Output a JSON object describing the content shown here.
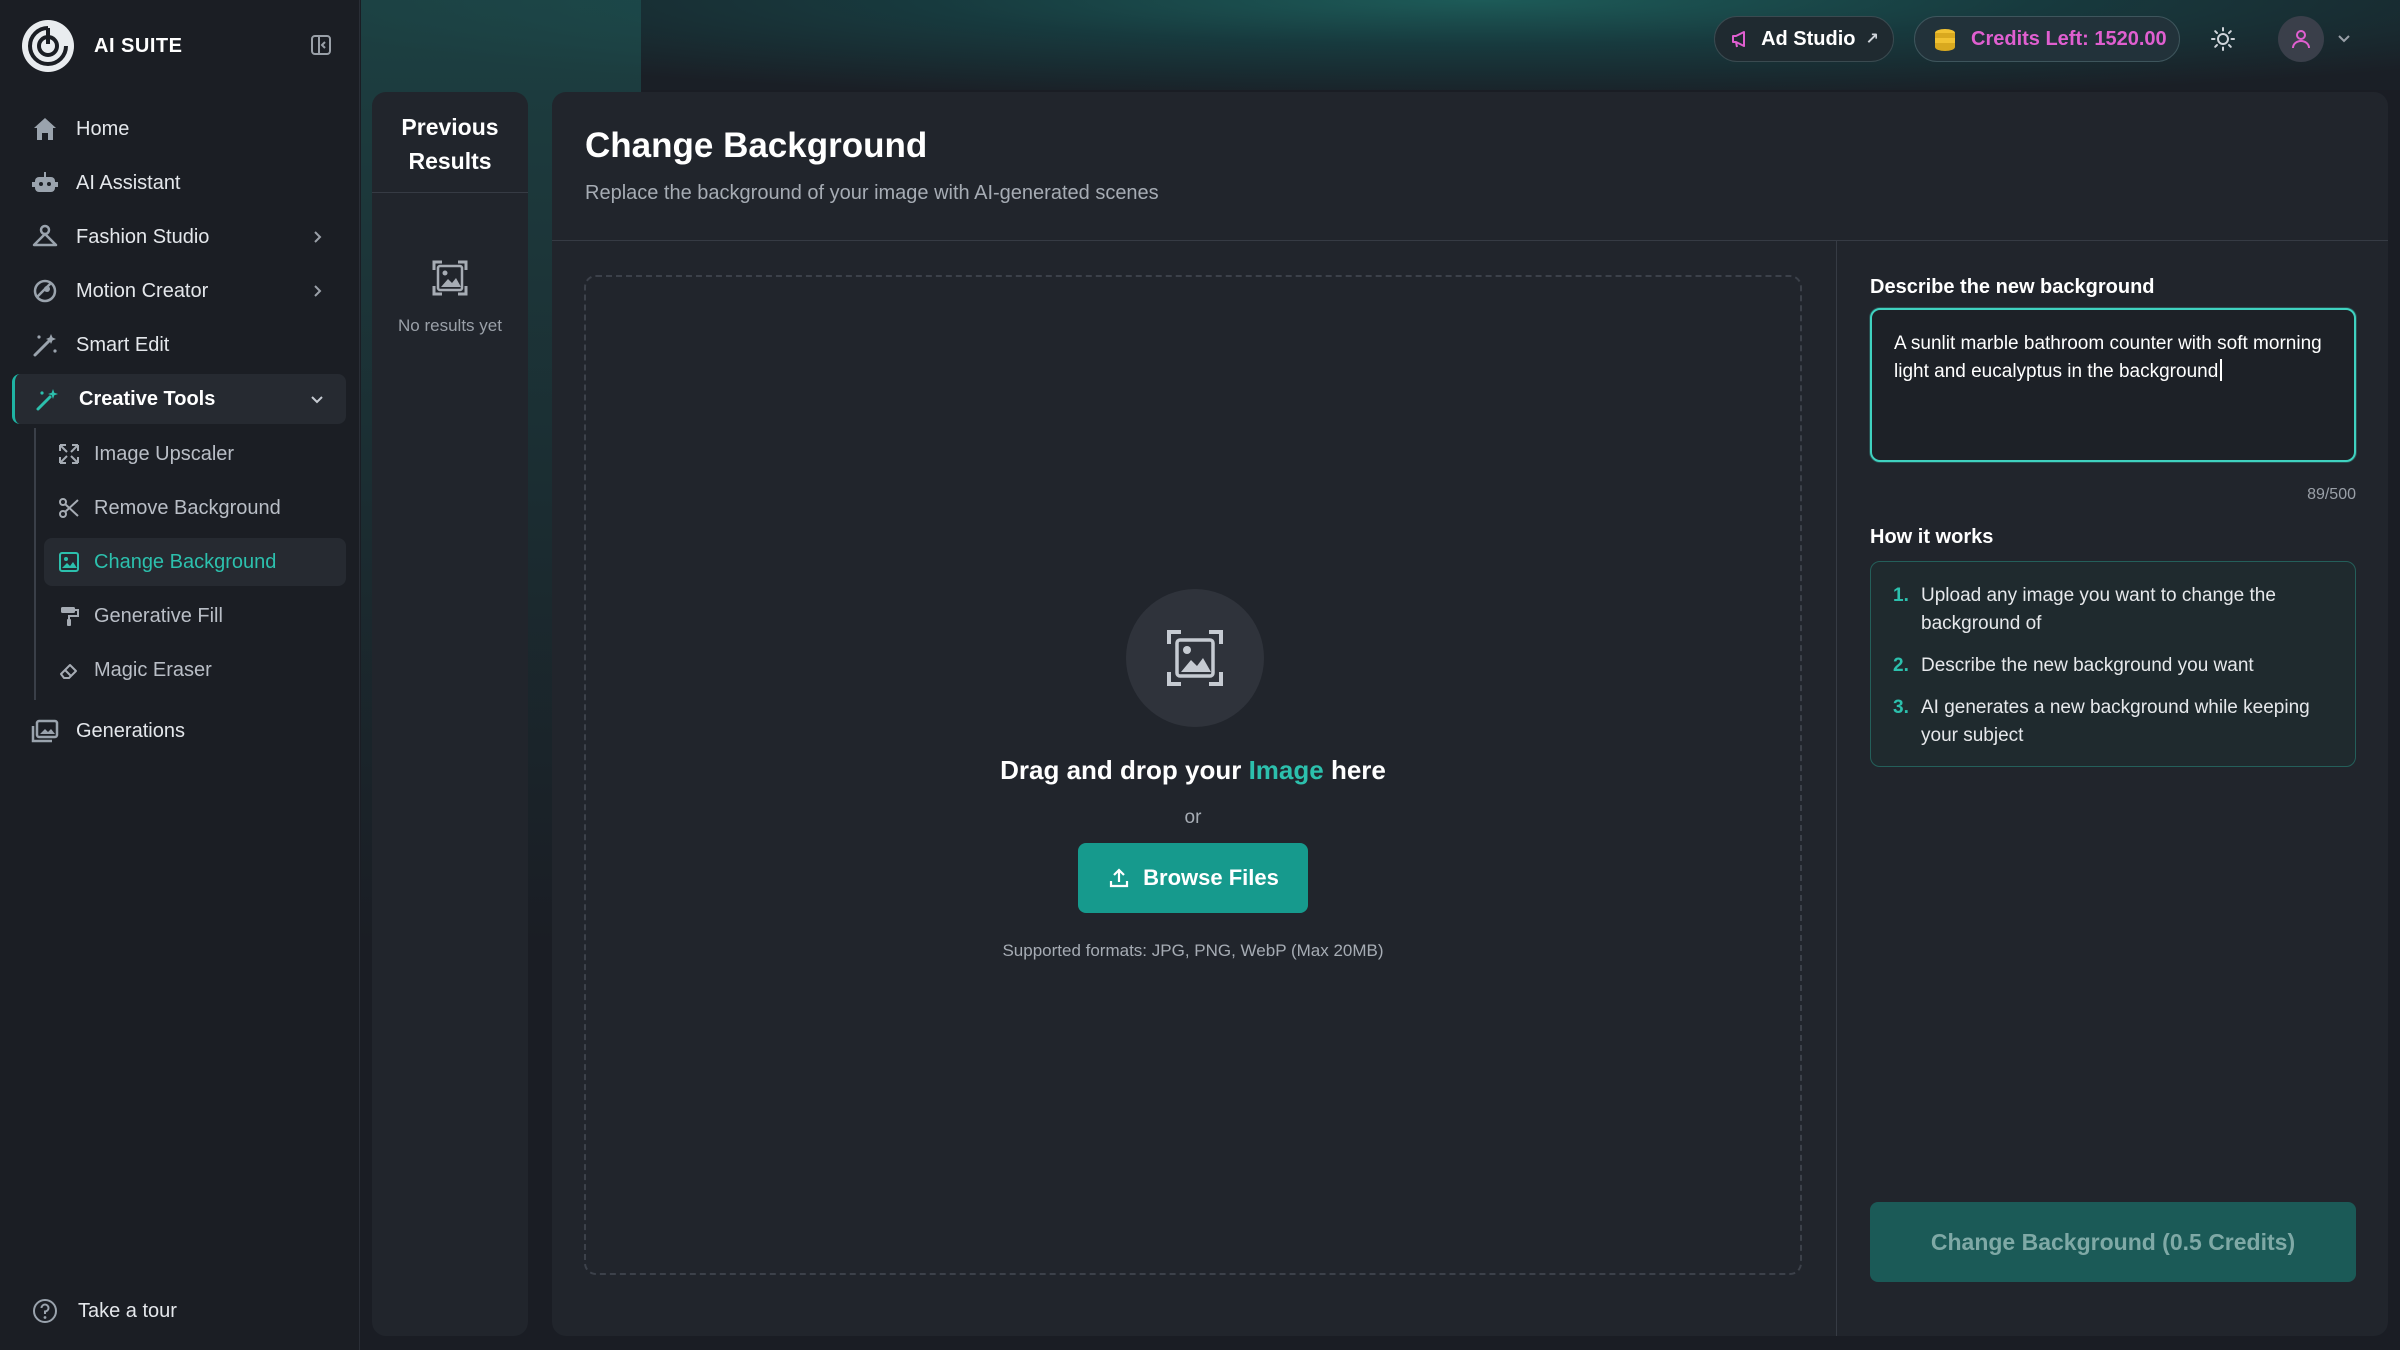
{
  "brand": {
    "name": "AI SUITE"
  },
  "sidebar": {
    "items": [
      {
        "label": "Home",
        "icon": "home-icon"
      },
      {
        "label": "AI Assistant",
        "icon": "robot-icon"
      },
      {
        "label": "Fashion Studio",
        "icon": "hanger-icon"
      },
      {
        "label": "Motion Creator",
        "icon": "motion-icon"
      },
      {
        "label": "Smart Edit",
        "icon": "magic-wand-icon"
      },
      {
        "label": "Creative Tools",
        "icon": "wand-sparkle-icon"
      },
      {
        "label": "Generations",
        "icon": "gallery-icon"
      }
    ],
    "sub_items": [
      {
        "label": "Image Upscaler",
        "icon": "expand-icon"
      },
      {
        "label": "Remove Background",
        "icon": "scissors-icon"
      },
      {
        "label": "Change Background",
        "icon": "image-frame-icon"
      },
      {
        "label": "Generative Fill",
        "icon": "paint-roller-icon"
      },
      {
        "label": "Magic Eraser",
        "icon": "eraser-icon"
      }
    ],
    "tour_label": "Take a tour"
  },
  "header": {
    "ad_studio_label": "Ad Studio",
    "credits_label": "Credits Left: 1520.00"
  },
  "previous": {
    "title": "Previous Results",
    "empty_text": "No results yet"
  },
  "main": {
    "title": "Change Background",
    "subtitle": "Replace the background of your image with AI-generated scenes",
    "dropzone": {
      "title_before": "Drag and drop your ",
      "title_highlight": "Image",
      "title_after": " here",
      "or_text": "or",
      "browse_label": "Browse Files",
      "formats": "Supported formats: JPG, PNG, WebP (Max 20MB)"
    },
    "describe_label": "Describe the new background",
    "description_value": "A sunlit marble bathroom counter with soft morning light and eucalyptus in the background",
    "char_count": "89/500",
    "how_label": "How it works",
    "steps": [
      {
        "num": "1.",
        "text": "Upload any image you want to change the background of"
      },
      {
        "num": "2.",
        "text": "Describe the new background you want"
      },
      {
        "num": "3.",
        "text": "AI generates a new background while keeping your subject"
      }
    ],
    "submit_label": "Change Background (0.5 Credits)"
  },
  "colors": {
    "accent": "#2cc0ad",
    "button": "#169a8d",
    "credits": "#e05fd0"
  }
}
